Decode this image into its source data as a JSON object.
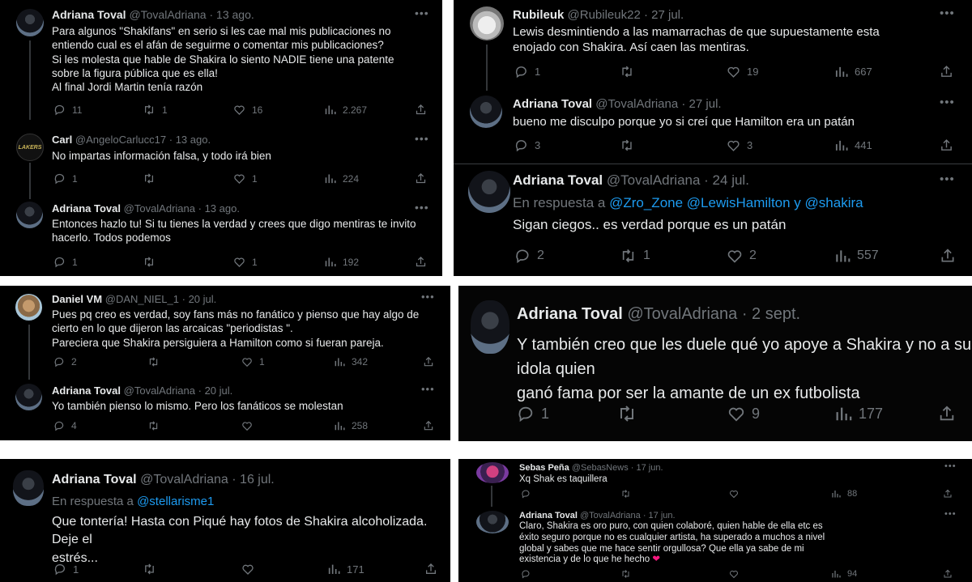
{
  "panels": {
    "p1": {
      "t1": {
        "name": "Adriana Toval",
        "handle": "@TovalAdriana",
        "time": "· 13 ago.",
        "lines": [
          "Para algunos \"Shakifans\" en serio si les cae mal mis publicaciones no",
          "entiendo cual es el afán de seguirme o comentar mis publicaciones?",
          "Si les molesta que hable de Shakira  lo siento NADIE tiene una patente",
          "sobre la figura pública que es ella!",
          "Al final Jordi Martin tenía razón"
        ],
        "replies": "11",
        "retweets": "1",
        "likes": "16",
        "views": "2.267"
      },
      "t2": {
        "name": "Carl",
        "handle": "@AngeloCarlucc17",
        "time": "· 13 ago.",
        "avatar_text": "LAKERS",
        "lines": [
          "No impartas información falsa, y todo irá bien"
        ],
        "replies": "1",
        "retweets": "",
        "likes": "1",
        "views": "224"
      },
      "t3": {
        "name": "Adriana Toval",
        "handle": "@TovalAdriana",
        "time": "· 13 ago.",
        "lines": [
          "Entonces hazlo tu! Si tu tienes la verdad y crees que digo mentiras te invito",
          "hacerlo. Todos podemos"
        ],
        "replies": "1",
        "retweets": "",
        "likes": "1",
        "views": "192"
      }
    },
    "p2": {
      "t1": {
        "name": "Rubileuk",
        "handle": "@Rubileuk22",
        "time": "· 27 jul.",
        "lines": [
          "Lewis desmintiendo a las mamarrachas de que supuestamente esta",
          "enojado con Shakira. Así caen las mentiras."
        ],
        "replies": "1",
        "retweets": "",
        "likes": "19",
        "views": "667"
      },
      "t2": {
        "name": "Adriana Toval",
        "handle": "@TovalAdriana",
        "time": "· 27 jul.",
        "lines": [
          "bueno me disculpo porque yo si creí que Hamilton era un patán"
        ],
        "replies": "3",
        "retweets": "",
        "likes": "3",
        "views": "441"
      },
      "t3": {
        "name": "Adriana Toval",
        "handle": "@TovalAdriana",
        "time": "· 24 jul.",
        "reply_prefix": "En respuesta a",
        "reply_mentions": "@Zro_Zone @LewisHamilton y @shakira",
        "lines": [
          "Sigan ciegos.. es verdad porque es un patán"
        ],
        "replies": "2",
        "retweets": "1",
        "likes": "2",
        "views": "557"
      }
    },
    "p3": {
      "t1": {
        "name": "Daniel VM",
        "handle": "@DAN_NIEL_1",
        "time": "· 20 jul.",
        "lines": [
          "Pues pq creo es verdad,  soy fans más no fanático y pienso que hay algo de",
          "cierto en lo que dijeron las arcaicas \"periodistas \".",
          "Pareciera que Shakira persiguiera a Hamilton como si fueran pareja."
        ],
        "replies": "2",
        "retweets": "",
        "likes": "1",
        "views": "342"
      },
      "t2": {
        "name": "Adriana Toval",
        "handle": "@TovalAdriana",
        "time": "· 20 jul.",
        "lines": [
          "Yo también pienso lo mismo. Pero los fanáticos se molestan"
        ],
        "replies": "4",
        "retweets": "",
        "likes": "",
        "views": "258"
      }
    },
    "p4": {
      "t1": {
        "name": "Adriana Toval",
        "handle": "@TovalAdriana",
        "time": "· 2 sept.",
        "lines": [
          "Y también creo que les duele qué yo apoye a Shakira y no a su idola quien",
          "ganó fama por ser la amante de un ex futbolista"
        ],
        "replies": "1",
        "retweets": "",
        "likes": "9",
        "views": "177"
      }
    },
    "p5": {
      "t1": {
        "name": "Adriana Toval",
        "handle": "@TovalAdriana",
        "time": "· 16 jul.",
        "reply_prefix": "En respuesta a",
        "reply_mentions": "@stellarisme1",
        "lines": [
          "Que tontería! Hasta con Piqué hay fotos de Shakira alcoholizada. Deje el",
          "estrés..."
        ],
        "replies": "1",
        "retweets": "",
        "likes": "",
        "views": "171"
      }
    },
    "p6": {
      "t1": {
        "name": "Sebas Peña",
        "handle": "@SebasNews",
        "time": "· 17 jun.",
        "lines": [
          "Xq Shak es taquillera"
        ],
        "replies": "",
        "retweets": "",
        "likes": "",
        "views": "88"
      },
      "t2": {
        "name": "Adriana Toval",
        "handle": "@TovalAdriana",
        "time": "· 17 jun.",
        "lines": [
          "Claro, Shakira es oro puro, con quien colaboré,  quien hable de ella etc es",
          "éxito seguro porque no es cualquier artista, ha superado a muchos a nivel",
          "global y sabes que me hace sentir orgullosa? Que ella ya sabe de mi",
          "existencia y de lo que he hecho"
        ],
        "emoji": "❤",
        "replies": "",
        "retweets": "",
        "likes": "",
        "views": "94"
      }
    }
  },
  "icons": {
    "reply": "reply-icon",
    "retweet": "retweet-icon",
    "like": "heart-icon",
    "views": "views-icon",
    "share": "share-icon",
    "more": "more-icon"
  },
  "colors": {
    "background": "#000000",
    "text": "#e7e9ea",
    "muted": "#71767b",
    "link": "#1d9bf0",
    "heart": "#f91880"
  }
}
